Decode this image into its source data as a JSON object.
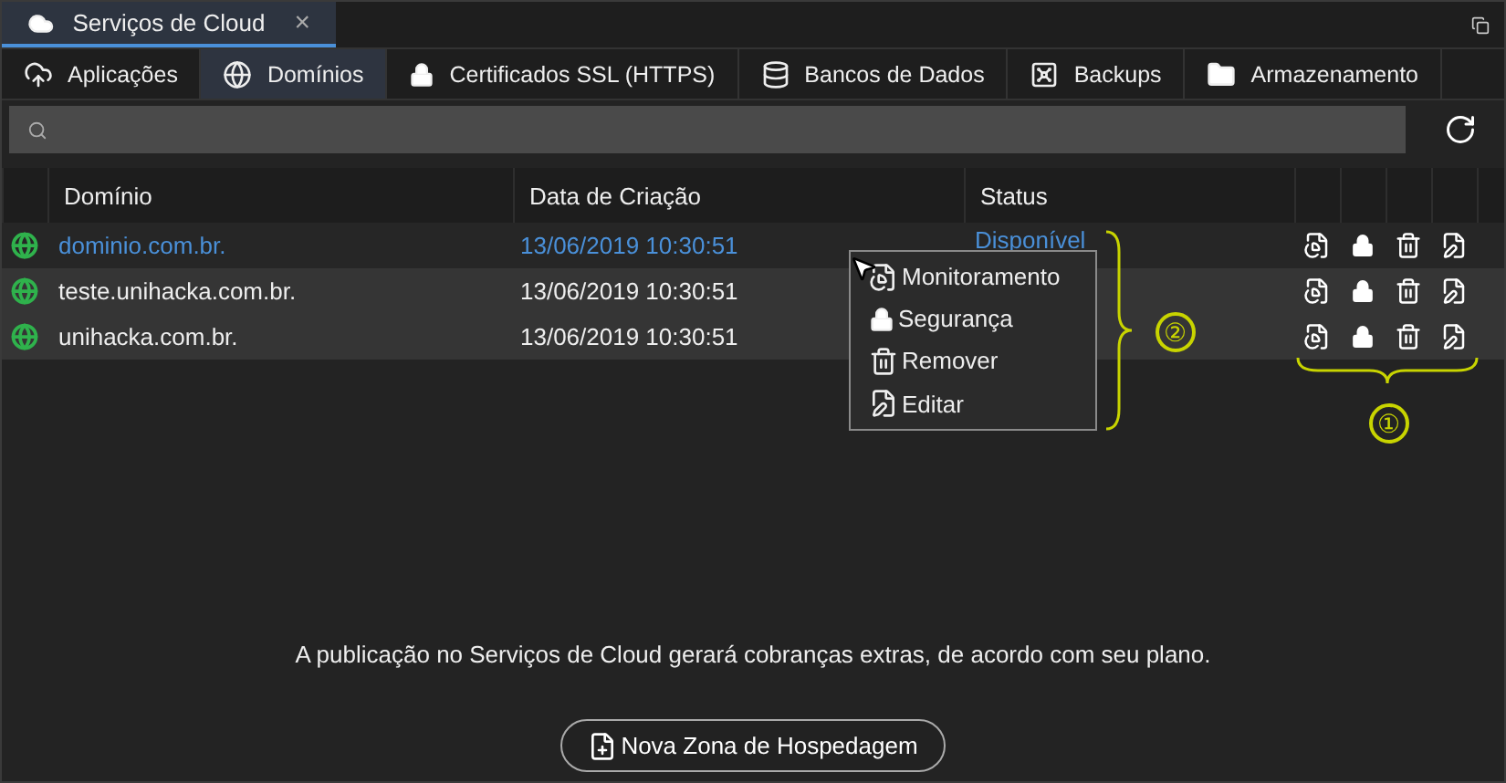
{
  "window": {
    "title": "Serviços de Cloud",
    "close": "×"
  },
  "tabs": [
    {
      "label": "Aplicações",
      "kind": "upload",
      "selected": false
    },
    {
      "label": "Domínios",
      "kind": "globe",
      "selected": true
    },
    {
      "label": "Certificados SSL (HTTPS)",
      "kind": "lock",
      "selected": false
    },
    {
      "label": "Bancos de Dados",
      "kind": "database",
      "selected": false
    },
    {
      "label": "Backups",
      "kind": "safe",
      "selected": false
    },
    {
      "label": "Armazenamento",
      "kind": "folder",
      "selected": false
    }
  ],
  "table": {
    "columns": [
      "Domínio",
      "Data de Criação",
      "Status"
    ],
    "rows": [
      {
        "domain": "dominio.com.br.",
        "created": "13/06/2019 10:30:51",
        "status": "Disponível",
        "selected": true
      },
      {
        "domain": "teste.unihacka.com.br.",
        "created": "13/06/2019 10:30:51",
        "selected": false
      },
      {
        "domain": "unihacka.com.br.",
        "created": "13/06/2019 10:30:51",
        "selected": false
      }
    ]
  },
  "context_menu": [
    {
      "kind": "monitor",
      "label": "Monitoramento"
    },
    {
      "kind": "lock",
      "label": "Segurança"
    },
    {
      "kind": "trash",
      "label": "Remover"
    },
    {
      "kind": "edit",
      "label": "Editar"
    }
  ],
  "annotations": [
    {
      "label": "②"
    },
    {
      "label": "①"
    }
  ],
  "notice": "A publicação no Serviços de Cloud gerará cobranças extras, de acordo com seu plano.",
  "button": "Nova Zona de Hospedagem"
}
